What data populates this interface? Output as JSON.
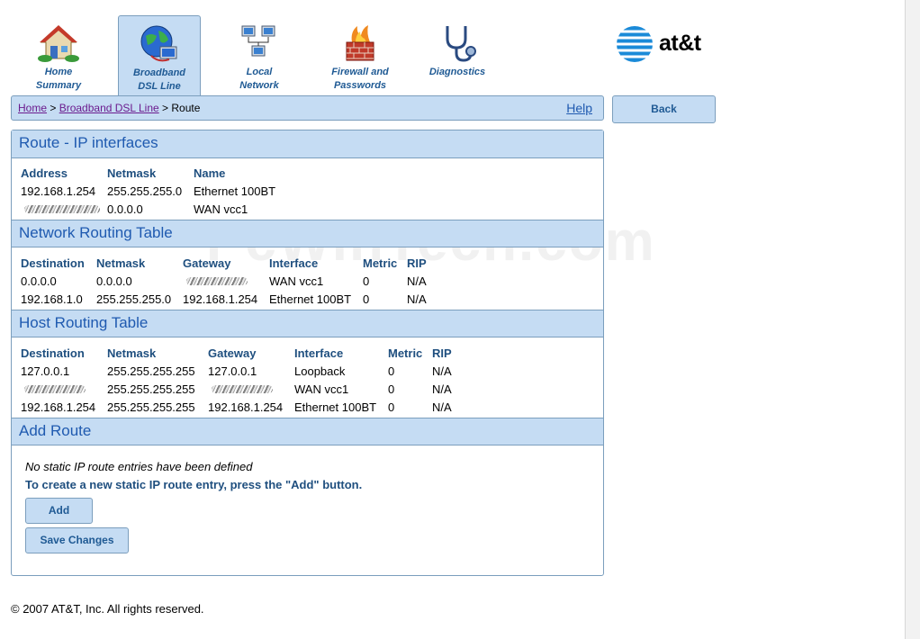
{
  "nav": [
    {
      "line1": "Home",
      "line2": "Summary"
    },
    {
      "line1": "Broadband",
      "line2": "DSL Line"
    },
    {
      "line1": "Local",
      "line2": "Network"
    },
    {
      "line1": "Firewall and",
      "line2": "Passwords"
    },
    {
      "line1": "Diagnostics",
      "line2": ""
    }
  ],
  "brand": {
    "logo_text": "at&t"
  },
  "breadcrumb": {
    "home": "Home",
    "sep1": " > ",
    "broadband": "Broadband DSL Line",
    "sep2": " > ",
    "current": "Route",
    "help": "Help"
  },
  "back_button": "Back",
  "ip_interfaces": {
    "title": "Route - IP interfaces",
    "headers": [
      "Address",
      "Netmask",
      "Name"
    ],
    "rows": [
      [
        "192.168.1.254",
        "255.255.255.0",
        "Ethernet 100BT"
      ],
      [
        "",
        "0.0.0.0",
        "WAN vcc1"
      ]
    ]
  },
  "network_routing": {
    "title": "Network Routing Table",
    "headers": [
      "Destination",
      "Netmask",
      "Gateway",
      "Interface",
      "Metric",
      "RIP"
    ],
    "rows": [
      [
        "0.0.0.0",
        "0.0.0.0",
        "",
        "WAN vcc1",
        "0",
        "N/A"
      ],
      [
        "192.168.1.0",
        "255.255.255.0",
        "192.168.1.254",
        "Ethernet 100BT",
        "0",
        "N/A"
      ]
    ]
  },
  "host_routing": {
    "title": "Host Routing Table",
    "headers": [
      "Destination",
      "Netmask",
      "Gateway",
      "Interface",
      "Metric",
      "RIP"
    ],
    "rows": [
      [
        "127.0.0.1",
        "255.255.255.255",
        "127.0.0.1",
        "Loopback",
        "0",
        "N/A"
      ],
      [
        "",
        "255.255.255.255",
        "",
        "WAN vcc1",
        "0",
        "N/A"
      ],
      [
        "192.168.1.254",
        "255.255.255.255",
        "192.168.1.254",
        "Ethernet 100BT",
        "0",
        "N/A"
      ]
    ]
  },
  "add_route": {
    "title": "Add Route",
    "no_entries": "No static IP route entries have been defined",
    "instruction": "To create a new static IP route entry, press the \"Add\" button.",
    "add_label": "Add",
    "save_label": "Save Changes"
  },
  "footer": "© 2007 AT&T, Inc. All rights reserved.",
  "watermark": "PcWinTech.com"
}
